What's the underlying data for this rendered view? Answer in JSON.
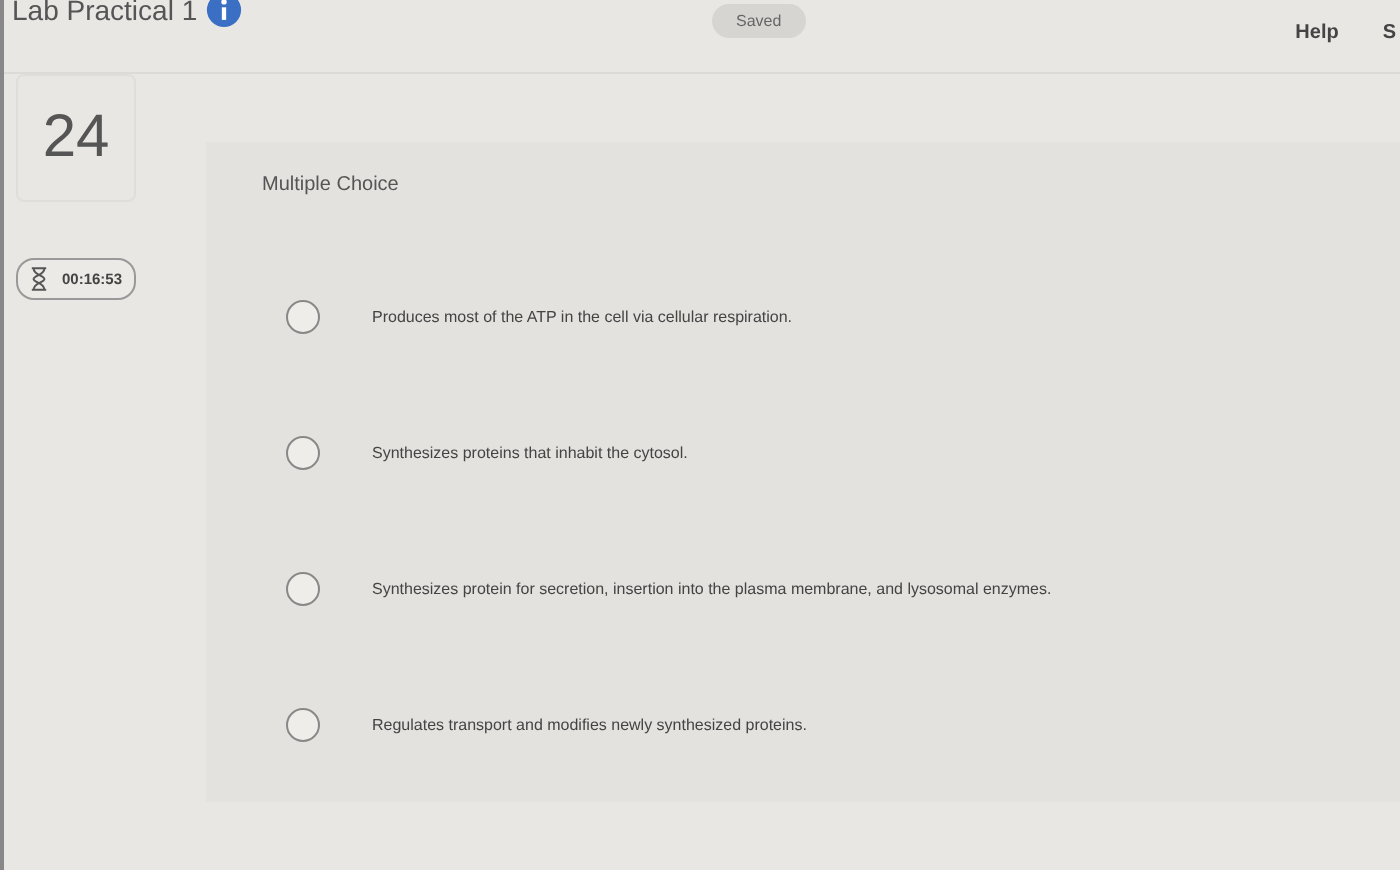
{
  "header": {
    "title": "Lab Practical 1",
    "status": "Saved",
    "links": [
      "Help",
      "S"
    ]
  },
  "question_number": "24",
  "timer": "00:16:53",
  "question": {
    "type": "Multiple Choice",
    "options": [
      {
        "text": "Produces most of the ATP in the cell via cellular respiration.",
        "selected": false
      },
      {
        "text": "Synthesizes proteins that inhabit the cytosol.",
        "selected": false
      },
      {
        "text": "Synthesizes protein for secretion, insertion into the plasma membrane, and lysosomal enzymes.",
        "selected": false
      },
      {
        "text": "Regulates transport and modifies newly synthesized proteins.",
        "selected": false
      }
    ]
  }
}
